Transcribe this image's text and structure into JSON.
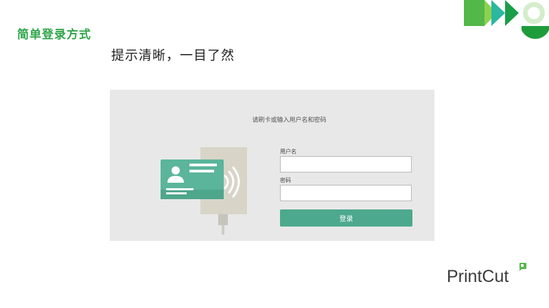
{
  "slide": {
    "title": "简单登录方式",
    "subtitle": "提示清晰，一目了然"
  },
  "login": {
    "prompt": "请刷卡或输入用户名和密码",
    "username_label": "用户名",
    "username_value": "",
    "password_label": "密码",
    "password_value": "",
    "login_button": "登录"
  },
  "brand": {
    "name": "PrintCut"
  },
  "colors": {
    "title_green": "#2ea548",
    "accent_teal": "#4da98e",
    "panel_bg": "#e8e8e8",
    "card": "#5bb59a"
  },
  "icons": {
    "card_reader": "card-reader-illustration",
    "id_card": "id-card-icon",
    "wireless": "wireless-signal-icon",
    "avatar": "avatar-icon"
  }
}
